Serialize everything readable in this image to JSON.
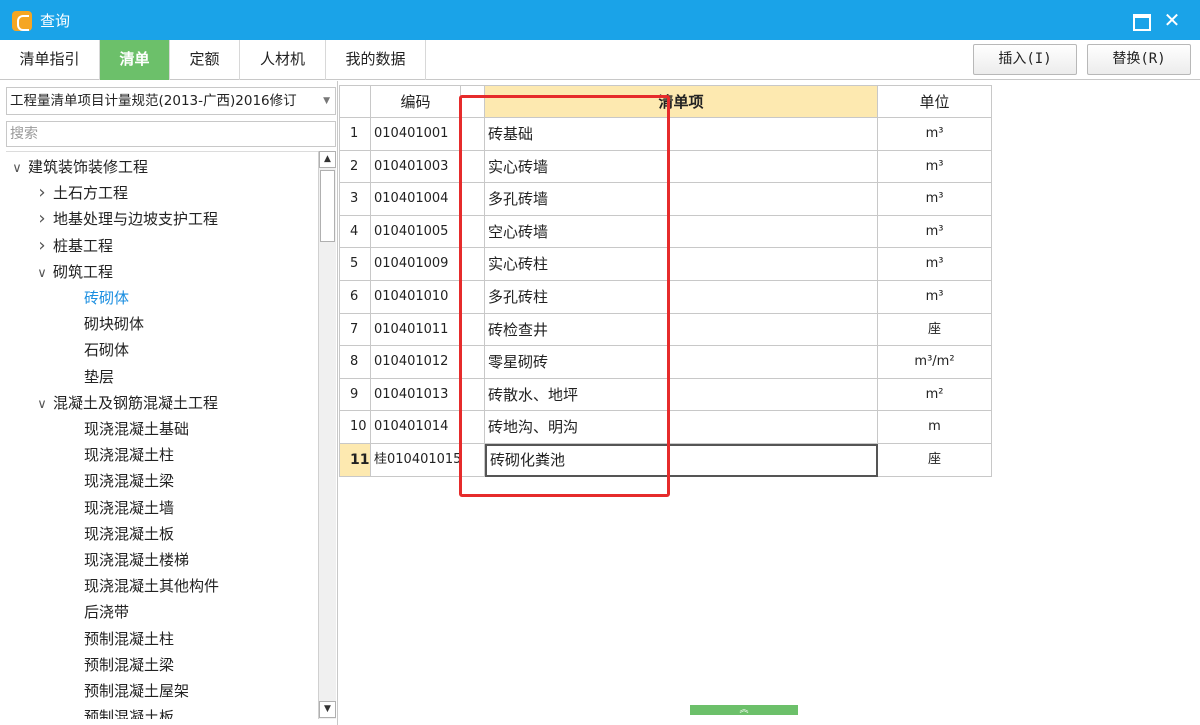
{
  "window": {
    "title": "查询",
    "maximize_icon": "maximize-icon",
    "close_glyph": "✕"
  },
  "tabs": [
    {
      "label": "清单指引",
      "active": false
    },
    {
      "label": "清单",
      "active": true
    },
    {
      "label": "定额",
      "active": false
    },
    {
      "label": "人材机",
      "active": false
    },
    {
      "label": "我的数据",
      "active": false
    }
  ],
  "toolbar": {
    "insert_label": "插入(I)",
    "replace_label": "替换(R)"
  },
  "left": {
    "spec_select": "工程量清单项目计量规范(2013-广西)2016修订",
    "search_placeholder": "搜索",
    "tree": [
      {
        "label": "建筑装饰装修工程",
        "level": 0,
        "toggle": "expanded"
      },
      {
        "label": "土石方工程",
        "level": 1,
        "toggle": "collapsed"
      },
      {
        "label": "地基处理与边坡支护工程",
        "level": 1,
        "toggle": "collapsed"
      },
      {
        "label": "桩基工程",
        "level": 1,
        "toggle": "collapsed"
      },
      {
        "label": "砌筑工程",
        "level": 1,
        "toggle": "expanded"
      },
      {
        "label": "砖砌体",
        "level": 2,
        "toggle": "none",
        "selected": true
      },
      {
        "label": "砌块砌体",
        "level": 2,
        "toggle": "none"
      },
      {
        "label": "石砌体",
        "level": 2,
        "toggle": "none"
      },
      {
        "label": "垫层",
        "level": 2,
        "toggle": "none"
      },
      {
        "label": "混凝土及钢筋混凝土工程",
        "level": 1,
        "toggle": "expanded"
      },
      {
        "label": "现浇混凝土基础",
        "level": 2,
        "toggle": "none"
      },
      {
        "label": "现浇混凝土柱",
        "level": 2,
        "toggle": "none"
      },
      {
        "label": "现浇混凝土梁",
        "level": 2,
        "toggle": "none"
      },
      {
        "label": "现浇混凝土墙",
        "level": 2,
        "toggle": "none"
      },
      {
        "label": "现浇混凝土板",
        "level": 2,
        "toggle": "none"
      },
      {
        "label": "现浇混凝土楼梯",
        "level": 2,
        "toggle": "none"
      },
      {
        "label": "现浇混凝土其他构件",
        "level": 2,
        "toggle": "none"
      },
      {
        "label": "后浇带",
        "level": 2,
        "toggle": "none"
      },
      {
        "label": "预制混凝土柱",
        "level": 2,
        "toggle": "none"
      },
      {
        "label": "预制混凝土梁",
        "level": 2,
        "toggle": "none"
      },
      {
        "label": "预制混凝土屋架",
        "level": 2,
        "toggle": "none"
      },
      {
        "label": "预制混凝土板",
        "level": 2,
        "toggle": "none"
      }
    ]
  },
  "grid": {
    "headers": {
      "code": "编码",
      "name": "清单项",
      "unit": "单位"
    },
    "rows": [
      {
        "no": "1",
        "code": "010401001",
        "name": "砖基础",
        "unit": "m³"
      },
      {
        "no": "2",
        "code": "010401003",
        "name": "实心砖墙",
        "unit": "m³"
      },
      {
        "no": "3",
        "code": "010401004",
        "name": "多孔砖墙",
        "unit": "m³"
      },
      {
        "no": "4",
        "code": "010401005",
        "name": "空心砖墙",
        "unit": "m³"
      },
      {
        "no": "5",
        "code": "010401009",
        "name": "实心砖柱",
        "unit": "m³"
      },
      {
        "no": "6",
        "code": "010401010",
        "name": "多孔砖柱",
        "unit": "m³"
      },
      {
        "no": "7",
        "code": "010401011",
        "name": "砖检查井",
        "unit": "座"
      },
      {
        "no": "8",
        "code": "010401012",
        "name": "零星砌砖",
        "unit": "m³/m²"
      },
      {
        "no": "9",
        "code": "010401013",
        "name": "砖散水、地坪",
        "unit": "m²"
      },
      {
        "no": "10",
        "code": "010401014",
        "name": "砖地沟、明沟",
        "unit": "m"
      },
      {
        "no": "11",
        "code": "桂010401015",
        "name": "砖砌化粪池",
        "unit": "座",
        "current": true
      }
    ]
  },
  "colors": {
    "titlebar": "#1aa3e8",
    "active_tab": "#6cc06a",
    "highlight": "#fde9b0",
    "annotation": "#e62b2b",
    "selected_tree": "#1a8ee0"
  },
  "bottom_handle_glyph": "︽"
}
